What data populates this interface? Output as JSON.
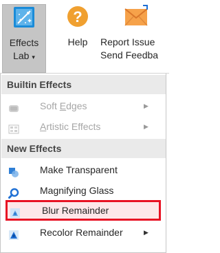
{
  "ribbon": {
    "effects_lab": {
      "line1": "Effects",
      "line2": "Lab",
      "caret": "▾"
    },
    "help": {
      "label": "Help"
    },
    "report": {
      "line1": "Report Issue",
      "line2": "Send Feedba"
    }
  },
  "menu": {
    "sections": [
      {
        "header": "Builtin Effects",
        "items": [
          {
            "label_pre": "Soft ",
            "label_u": "E",
            "label_post": "dges",
            "icon": "soft-edges-icon",
            "disabled": true,
            "submenu": true
          },
          {
            "label_pre": "",
            "label_u": "A",
            "label_post": "rtistic Effects",
            "icon": "artistic-effects-icon",
            "disabled": true,
            "submenu": true
          }
        ]
      },
      {
        "header": "New Effects",
        "items": [
          {
            "label": "Make Transparent",
            "icon": "transparency-icon"
          },
          {
            "label": "Magnifying Glass",
            "icon": "magnifier-icon"
          },
          {
            "label": "Blur Remainder",
            "icon": "blur-icon",
            "highlighted": true
          },
          {
            "label": "Recolor Remainder",
            "icon": "recolor-icon",
            "submenu": true
          }
        ]
      }
    ],
    "submenu_arrow": "▶"
  },
  "colors": {
    "highlight_border": "#e81123",
    "highlight_fill": "#fde7e9",
    "accent_blue": "#1e6fd4",
    "help_orange": "#f0a030"
  }
}
